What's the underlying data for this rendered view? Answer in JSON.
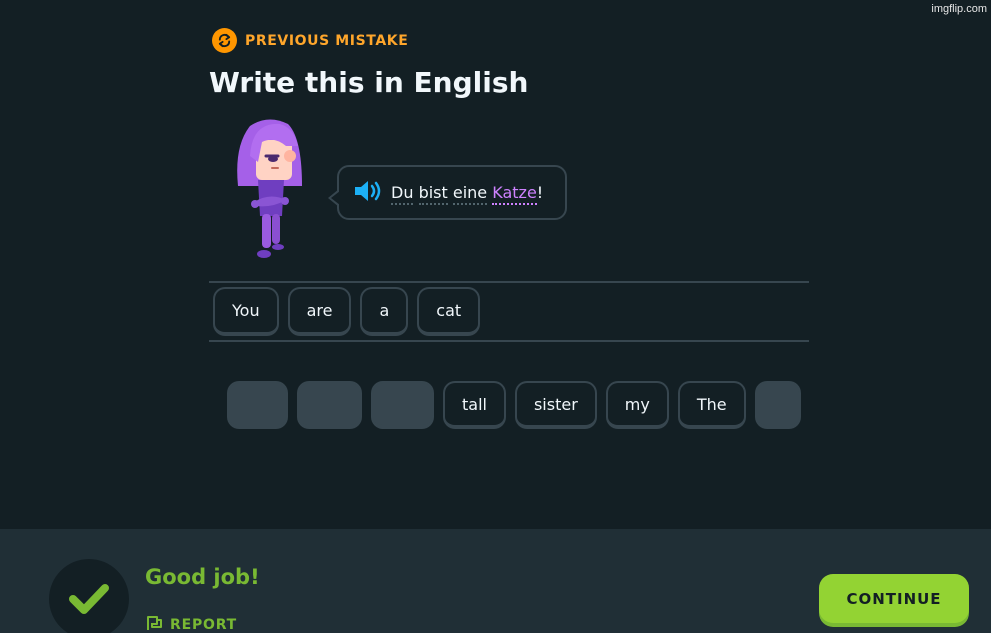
{
  "watermark": "imgflip.com",
  "header": {
    "badge_icon": "repeat-icon",
    "badge_label": "PREVIOUS MISTAKE",
    "title": "Write this in English"
  },
  "prompt": {
    "speaker_icon": "speaker-icon",
    "words": [
      "Du",
      "bist",
      "eine",
      "Katze"
    ],
    "punctuation": "!",
    "highlight_color": "#ce82ff"
  },
  "answer": {
    "tiles": [
      "You",
      "are",
      "a",
      "cat"
    ]
  },
  "word_bank": {
    "tiles": [
      {
        "label": "",
        "used": true
      },
      {
        "label": "",
        "used": true
      },
      {
        "label": "",
        "used": true
      },
      {
        "label": "tall",
        "used": false
      },
      {
        "label": "sister",
        "used": false
      },
      {
        "label": "my",
        "used": false
      },
      {
        "label": "The",
        "used": false
      },
      {
        "label": "",
        "used": true
      }
    ]
  },
  "footer": {
    "status": "Good job!",
    "status_icon": "checkmark-icon",
    "report_icon": "flag-icon",
    "report_label": "REPORT",
    "continue_label": "CONTINUE",
    "accent_color": "#93d333"
  }
}
